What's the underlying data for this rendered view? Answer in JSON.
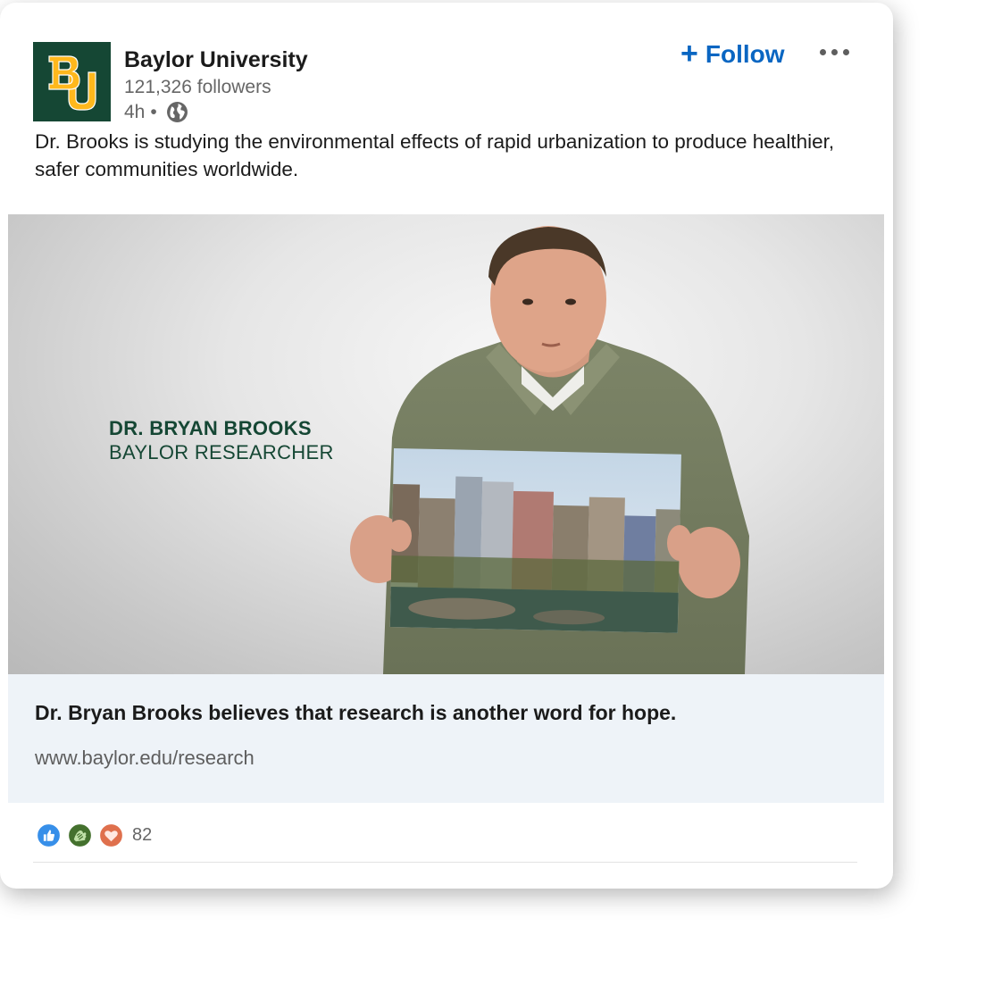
{
  "post": {
    "company_name": "Baylor University",
    "followers": "121,326 followers",
    "time": "4h",
    "separator": "•",
    "follow_label": "Follow",
    "text": "Dr. Brooks is studying the environmental effects of rapid urbanization to produce healthier, safer communities worldwide."
  },
  "hero": {
    "name": "DR. BRYAN BROOKS",
    "role": "BAYLOR RESEARCHER"
  },
  "link": {
    "title": "Dr. Bryan Brooks believes that research is another word for hope.",
    "url": "www.baylor.edu/research"
  },
  "reactions": {
    "icons": [
      "like-icon",
      "celebrate-icon",
      "love-icon"
    ],
    "count": "82"
  },
  "colors": {
    "baylor_green": "#154734",
    "baylor_gold": "#ffb81c",
    "linkedin_blue": "#0a66c2",
    "link_bg": "#eef3f8"
  }
}
